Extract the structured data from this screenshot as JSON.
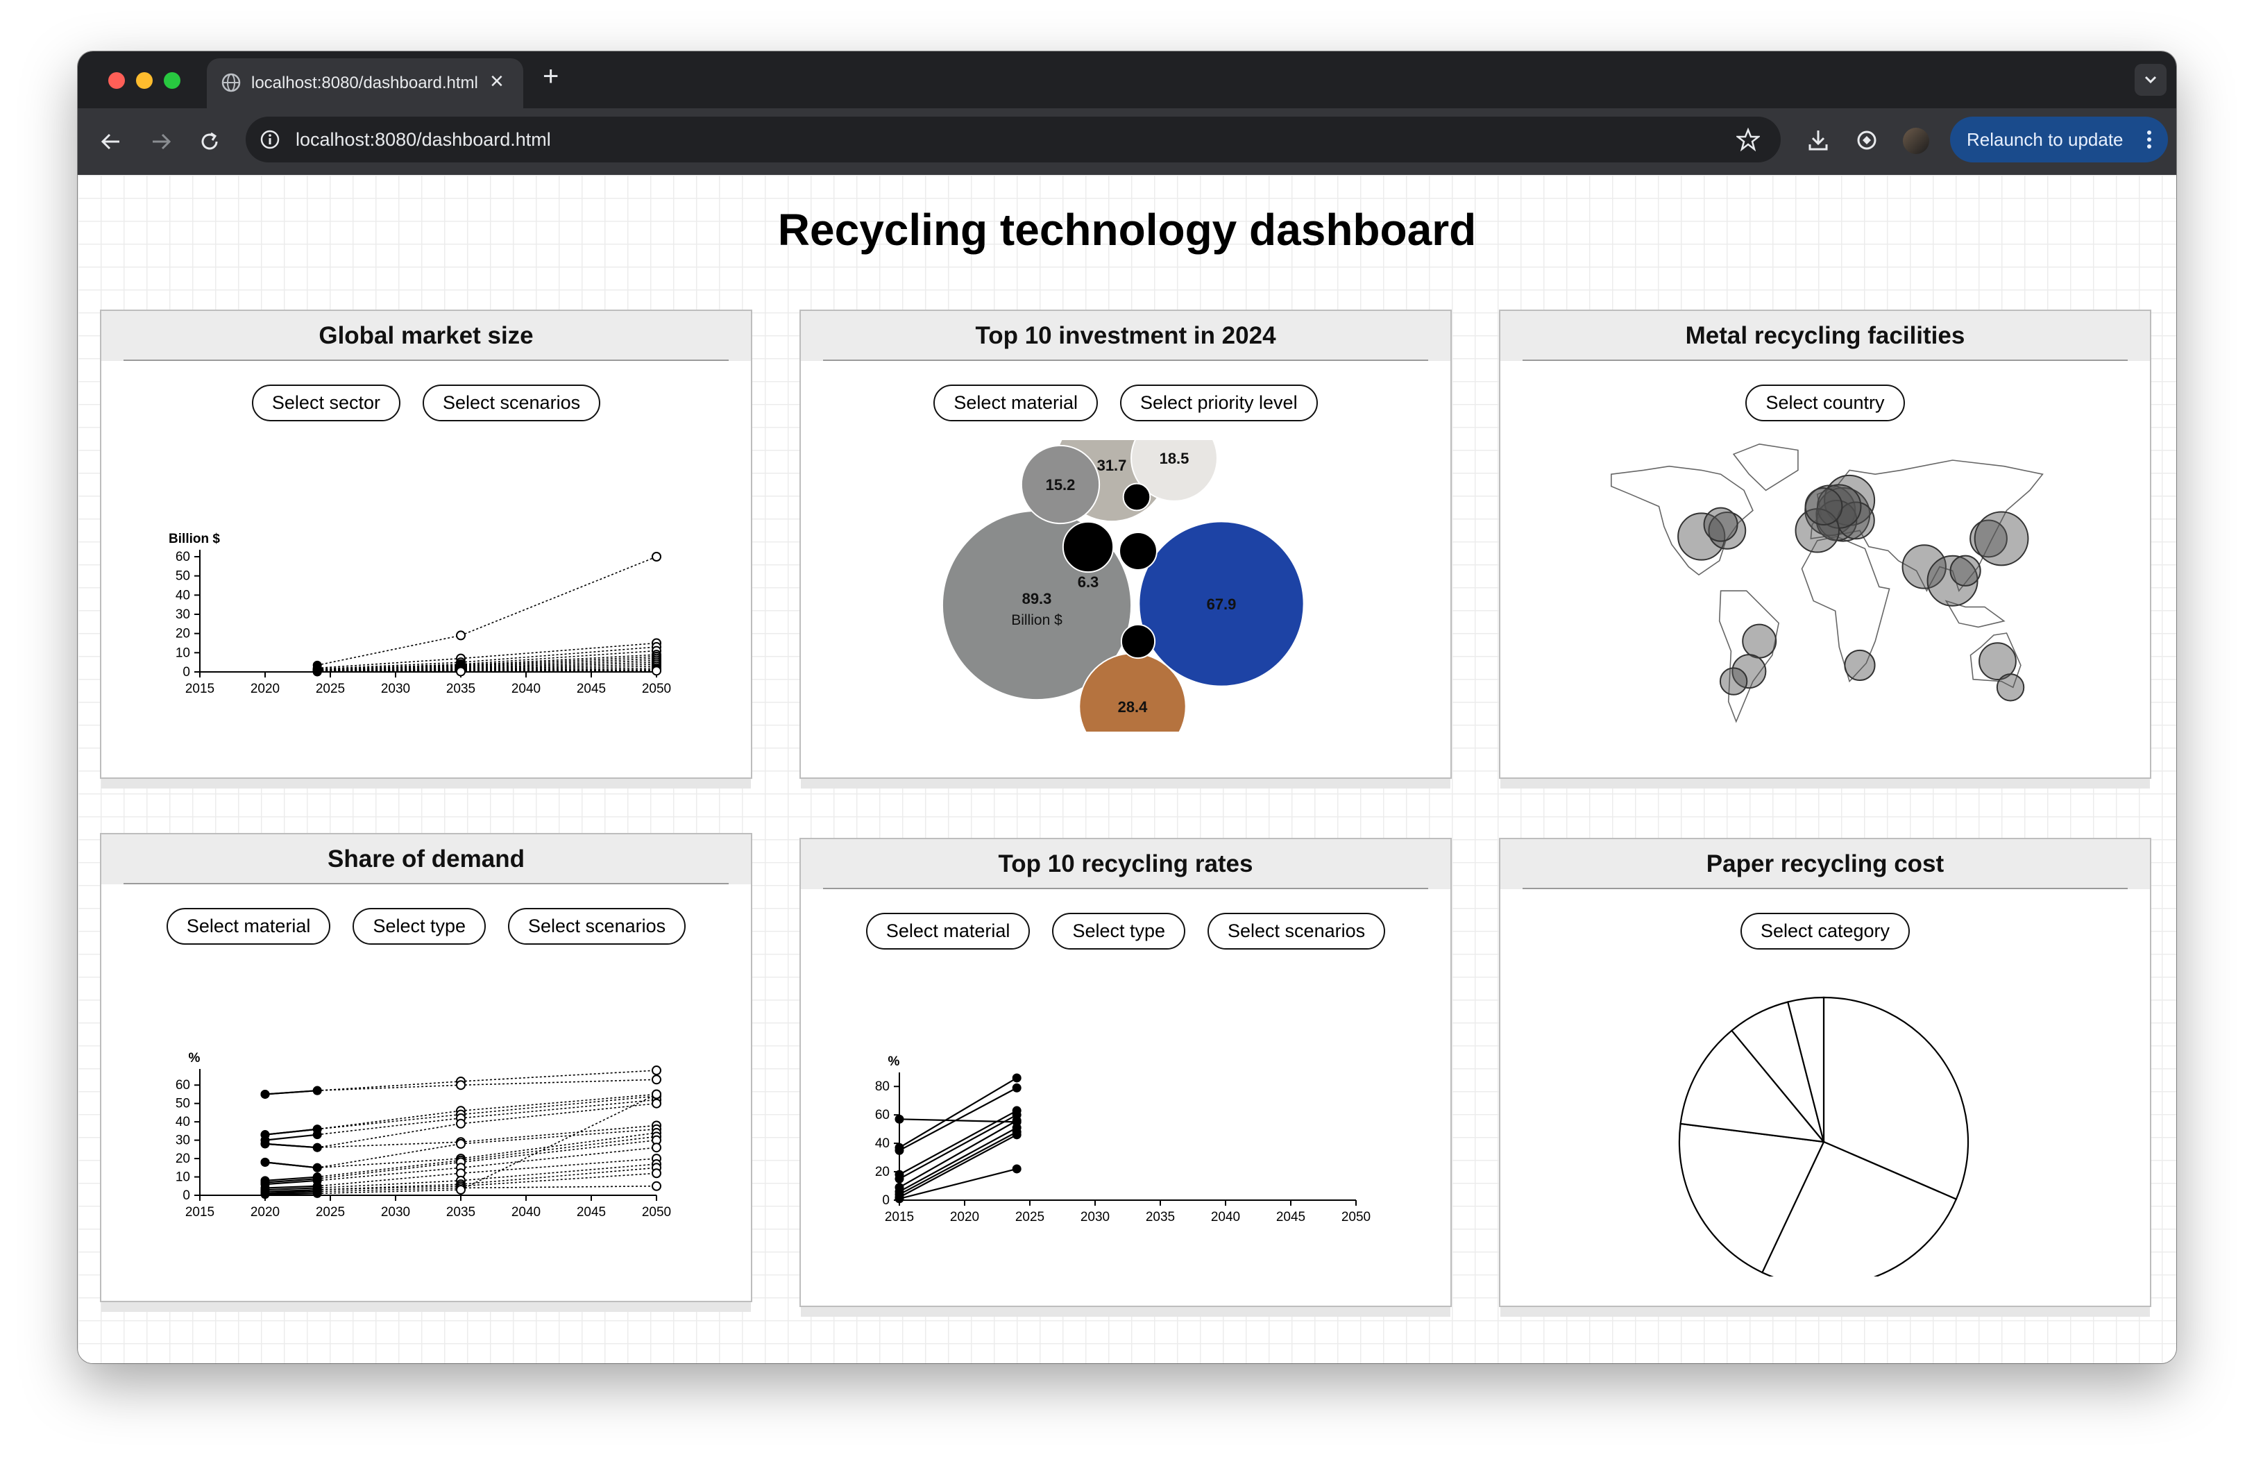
{
  "browser": {
    "tab_title": "localhost:8080/dashboard.html",
    "url": "localhost:8080/dashboard.html",
    "relaunch_label": "Relaunch to update",
    "new_tab_glyph": "+",
    "close_glyph": "×",
    "colors": {
      "frame": "#202124",
      "toolbar": "#35363a",
      "relaunch": "#1a4b8c"
    }
  },
  "page": {
    "title": "Recycling technology dashboard"
  },
  "cards": {
    "market": {
      "title": "Global market size",
      "buttons": [
        "Select sector",
        "Select scenarios"
      ]
    },
    "investment": {
      "title": "Top 10 investment in 2024",
      "buttons": [
        "Select material",
        "Select priority level"
      ]
    },
    "facilities": {
      "title": "Metal recycling facilities",
      "buttons": [
        "Select country"
      ]
    },
    "demand": {
      "title": "Share of demand",
      "buttons": [
        "Select material",
        "Select type",
        "Select scenarios"
      ]
    },
    "rates": {
      "title": "Top 10 recycling rates",
      "buttons": [
        "Select material",
        "Select type",
        "Select scenarios"
      ]
    },
    "paper": {
      "title": "Paper recycling cost",
      "buttons": [
        "Select category"
      ]
    }
  },
  "chart_data": [
    {
      "id": "market",
      "type": "line",
      "ylabel": "Billion $",
      "xlim": [
        2015,
        2050
      ],
      "ylim": [
        0,
        60
      ],
      "xticks": [
        2015,
        2020,
        2025,
        2030,
        2035,
        2040,
        2045,
        2050
      ],
      "yticks": [
        0,
        10,
        20,
        30,
        40,
        50,
        60
      ],
      "series": [
        {
          "values": [
            [
              2024,
              3.5
            ],
            [
              2035,
              19
            ],
            [
              2050,
              60
            ]
          ]
        },
        {
          "values": [
            [
              2024,
              2
            ],
            [
              2035,
              7
            ],
            [
              2050,
              15
            ]
          ]
        },
        {
          "values": [
            [
              2024,
              1.5
            ],
            [
              2035,
              5
            ],
            [
              2050,
              13
            ]
          ]
        },
        {
          "values": [
            [
              2024,
              1.2
            ],
            [
              2035,
              4
            ],
            [
              2050,
              11
            ]
          ]
        },
        {
          "values": [
            [
              2024,
              1
            ],
            [
              2035,
              3.5
            ],
            [
              2050,
              9
            ]
          ]
        },
        {
          "values": [
            [
              2024,
              0.8
            ],
            [
              2035,
              3
            ],
            [
              2050,
              8
            ]
          ]
        },
        {
          "values": [
            [
              2024,
              0.6
            ],
            [
              2035,
              2.5
            ],
            [
              2050,
              7
            ]
          ]
        },
        {
          "values": [
            [
              2024,
              0.5
            ],
            [
              2035,
              2
            ],
            [
              2050,
              6
            ]
          ]
        },
        {
          "values": [
            [
              2024,
              0.4
            ],
            [
              2035,
              1.6
            ],
            [
              2050,
              5
            ]
          ]
        },
        {
          "values": [
            [
              2024,
              0.3
            ],
            [
              2035,
              1.2
            ],
            [
              2050,
              4
            ]
          ]
        },
        {
          "values": [
            [
              2024,
              0.2
            ],
            [
              2035,
              0.9
            ],
            [
              2050,
              3
            ]
          ]
        },
        {
          "values": [
            [
              2024,
              0.15
            ],
            [
              2035,
              0.6
            ],
            [
              2050,
              2
            ]
          ]
        },
        {
          "values": [
            [
              2024,
              0.1
            ],
            [
              2035,
              0.4
            ],
            [
              2050,
              1.2
            ]
          ]
        },
        {
          "values": [
            [
              2024,
              0.05
            ],
            [
              2035,
              0.2
            ],
            [
              2050,
              0.6
            ]
          ]
        }
      ]
    },
    {
      "id": "investment",
      "type": "bubble",
      "unit_label": "Billion $",
      "bubbles": [
        {
          "value": 89.3,
          "label": "89.3",
          "color": "#8a8c8c"
        },
        {
          "value": 67.9,
          "label": "67.9",
          "color": "#1d43a5"
        },
        {
          "value": 31.7,
          "label": "31.7",
          "color": "#b8b4ac"
        },
        {
          "value": 28.4,
          "label": "28.4",
          "color": "#b5733f"
        },
        {
          "value": 18.5,
          "label": "18.5",
          "color": "#e8e6e3"
        },
        {
          "value": 15.2,
          "label": "15.2",
          "color": "#8f8f8f"
        },
        {
          "value": 6.3,
          "label": "6.3",
          "color": "#000000"
        },
        {
          "value": 3.5,
          "label": "",
          "color": "#000000"
        },
        {
          "value": 2.8,
          "label": "",
          "color": "#000000"
        },
        {
          "value": 1.8,
          "label": "",
          "color": "#000000"
        }
      ]
    },
    {
      "id": "facilities",
      "type": "map",
      "marker_color": "#555555",
      "markers": [
        {
          "lon": -95,
          "lat": 37,
          "size": 1.4
        },
        {
          "lon": -75,
          "lat": 40,
          "size": 1.1
        },
        {
          "lon": -80,
          "lat": 43,
          "size": 1.0
        },
        {
          "lon": -50,
          "lat": -15,
          "size": 1.0
        },
        {
          "lon": -58,
          "lat": -30,
          "size": 1.0
        },
        {
          "lon": -70,
          "lat": -35,
          "size": 0.8
        },
        {
          "lon": 5,
          "lat": 50,
          "size": 1.5
        },
        {
          "lon": 15,
          "lat": 48,
          "size": 1.6
        },
        {
          "lon": 20,
          "lat": 55,
          "size": 1.5
        },
        {
          "lon": 10,
          "lat": 45,
          "size": 1.2
        },
        {
          "lon": 25,
          "lat": 45,
          "size": 1.1
        },
        {
          "lon": 12,
          "lat": 52,
          "size": 1.3
        },
        {
          "lon": -5,
          "lat": 40,
          "size": 1.3
        },
        {
          "lon": 0,
          "lat": 52,
          "size": 1.1
        },
        {
          "lon": 28,
          "lat": -27,
          "size": 0.9
        },
        {
          "lon": 78,
          "lat": 22,
          "size": 1.3
        },
        {
          "lon": 100,
          "lat": 15,
          "size": 1.5
        },
        {
          "lon": 110,
          "lat": 20,
          "size": 0.9
        },
        {
          "lon": 128,
          "lat": 36,
          "size": 1.1
        },
        {
          "lon": 138,
          "lat": 36,
          "size": 1.6
        },
        {
          "lon": 135,
          "lat": -25,
          "size": 1.1
        },
        {
          "lon": 145,
          "lat": -38,
          "size": 0.8
        }
      ]
    },
    {
      "id": "demand",
      "type": "line",
      "ylabel": "%",
      "xlim": [
        2015,
        2050
      ],
      "ylim": [
        0,
        65
      ],
      "xticks": [
        2015,
        2020,
        2025,
        2030,
        2035,
        2040,
        2045,
        2050
      ],
      "yticks": [
        0,
        10,
        20,
        30,
        40,
        50,
        60
      ],
      "series": [
        {
          "values": [
            [
              2020,
              55
            ],
            [
              2024,
              57
            ],
            [
              2035,
              62
            ],
            [
              2050,
              68
            ]
          ]
        },
        {
          "values": [
            [
              2020,
              55
            ],
            [
              2024,
              57
            ],
            [
              2035,
              60
            ],
            [
              2050,
              63
            ]
          ]
        },
        {
          "values": [
            [
              2020,
              33
            ],
            [
              2024,
              36
            ],
            [
              2035,
              46
            ],
            [
              2050,
              55
            ]
          ]
        },
        {
          "values": [
            [
              2020,
              33
            ],
            [
              2024,
              36
            ],
            [
              2035,
              44
            ],
            [
              2050,
              54
            ]
          ]
        },
        {
          "values": [
            [
              2020,
              30
            ],
            [
              2024,
              33
            ],
            [
              2035,
              42
            ],
            [
              2050,
              52
            ]
          ]
        },
        {
          "values": [
            [
              2020,
              28
            ],
            [
              2024,
              26
            ],
            [
              2035,
              39
            ],
            [
              2050,
              50
            ]
          ]
        },
        {
          "values": [
            [
              2020,
              28
            ],
            [
              2024,
              26
            ],
            [
              2035,
              29
            ],
            [
              2050,
              38
            ]
          ]
        },
        {
          "values": [
            [
              2020,
              18
            ],
            [
              2024,
              15
            ],
            [
              2035,
              28
            ],
            [
              2050,
              36
            ]
          ]
        },
        {
          "values": [
            [
              2020,
              18
            ],
            [
              2024,
              15
            ],
            [
              2035,
              20
            ],
            [
              2050,
              34
            ]
          ]
        },
        {
          "values": [
            [
              2020,
              8
            ],
            [
              2024,
              10
            ],
            [
              2035,
              19
            ],
            [
              2050,
              32
            ]
          ]
        },
        {
          "values": [
            [
              2020,
              7
            ],
            [
              2024,
              9
            ],
            [
              2035,
              18
            ],
            [
              2050,
              30
            ]
          ]
        },
        {
          "values": [
            [
              2020,
              6
            ],
            [
              2024,
              8
            ],
            [
              2035,
              15
            ],
            [
              2050,
              26
            ]
          ]
        },
        {
          "values": [
            [
              2020,
              4
            ],
            [
              2024,
              5
            ],
            [
              2035,
              12
            ],
            [
              2050,
              20
            ]
          ]
        },
        {
          "values": [
            [
              2020,
              3
            ],
            [
              2024,
              4
            ],
            [
              2035,
              8
            ],
            [
              2050,
              17
            ]
          ]
        },
        {
          "values": [
            [
              2020,
              2
            ],
            [
              2024,
              3
            ],
            [
              2035,
              6
            ],
            [
              2050,
              15
            ]
          ]
        },
        {
          "values": [
            [
              2020,
              1
            ],
            [
              2024,
              3
            ],
            [
              2035,
              5
            ],
            [
              2050,
              12
            ]
          ]
        },
        {
          "values": [
            [
              2020,
              1
            ],
            [
              2024,
              2
            ],
            [
              2035,
              4
            ],
            [
              2050,
              5
            ]
          ]
        },
        {
          "values": [
            [
              2020,
              0.5
            ],
            [
              2024,
              1
            ],
            [
              2035,
              3
            ],
            [
              2050,
              55
            ]
          ]
        }
      ]
    },
    {
      "id": "rates",
      "type": "line",
      "ylabel": "%",
      "xlim": [
        2015,
        2050
      ],
      "ylim": [
        0,
        85
      ],
      "xticks": [
        2015,
        2020,
        2025,
        2030,
        2035,
        2040,
        2045,
        2050
      ],
      "yticks": [
        0,
        20,
        40,
        60,
        80
      ],
      "series": [
        {
          "values": [
            [
              2015,
              57
            ],
            [
              2024,
              55
            ]
          ]
        },
        {
          "values": [
            [
              2015,
              37
            ],
            [
              2024,
              86
            ]
          ]
        },
        {
          "values": [
            [
              2015,
              35
            ],
            [
              2024,
              79
            ]
          ]
        },
        {
          "values": [
            [
              2015,
              18
            ],
            [
              2024,
              63
            ]
          ]
        },
        {
          "values": [
            [
              2015,
              15
            ],
            [
              2024,
              60
            ]
          ]
        },
        {
          "values": [
            [
              2015,
              9
            ],
            [
              2024,
              56
            ]
          ]
        },
        {
          "values": [
            [
              2015,
              6
            ],
            [
              2024,
              51
            ]
          ]
        },
        {
          "values": [
            [
              2015,
              4
            ],
            [
              2024,
              48
            ]
          ]
        },
        {
          "values": [
            [
              2015,
              2
            ],
            [
              2024,
              46
            ]
          ]
        },
        {
          "values": [
            [
              2015,
              1
            ],
            [
              2024,
              22
            ]
          ]
        }
      ]
    },
    {
      "id": "paper",
      "type": "pie",
      "slices": [
        {
          "value": 31.5,
          "label": ""
        },
        {
          "value": 25.5,
          "label": ""
        },
        {
          "value": 20,
          "label": ""
        },
        {
          "value": 12,
          "label": ""
        },
        {
          "value": 7,
          "label": ""
        },
        {
          "value": 4,
          "label": ""
        }
      ]
    }
  ]
}
